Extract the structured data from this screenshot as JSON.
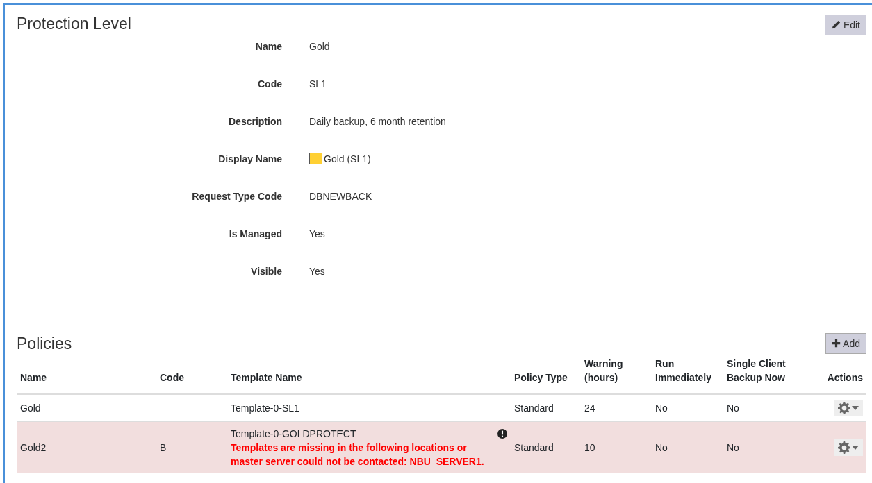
{
  "protection_level": {
    "title": "Protection Level",
    "edit_button": "Edit",
    "fields": [
      {
        "label": "Name",
        "value": "Gold"
      },
      {
        "label": "Code",
        "value": "SL1"
      },
      {
        "label": "Description",
        "value": "Daily backup, 6 month retention"
      },
      {
        "label": "Display Name",
        "value": "Gold (SL1)",
        "color": "#ffd033"
      },
      {
        "label": "Request Type Code",
        "value": "DBNEWBACK"
      },
      {
        "label": "Is Managed",
        "value": "Yes"
      },
      {
        "label": "Visible",
        "value": "Yes"
      }
    ]
  },
  "policies": {
    "title": "Policies",
    "add_button": "Add",
    "columns": [
      "Name",
      "Code",
      "Template Name",
      "Policy Type",
      "Warning (hours)",
      "Run Immediately",
      "Single Client Backup Now",
      "Actions"
    ],
    "rows": [
      {
        "name": "Gold",
        "code": "",
        "template_name": "Template-0-SL1",
        "policy_type": "Standard",
        "warning_hours": "24",
        "run_immediately": "No",
        "single_client_backup_now": "No",
        "error": false
      },
      {
        "name": "Gold2",
        "code": "B",
        "template_name": "Template-0-GOLDPROTECT",
        "error_message": "Templates are missing in the following locations or master server could not be contacted: NBU_SERVER1.",
        "policy_type": "Standard",
        "warning_hours": "10",
        "run_immediately": "No",
        "single_client_backup_now": "No",
        "error": true
      }
    ]
  }
}
